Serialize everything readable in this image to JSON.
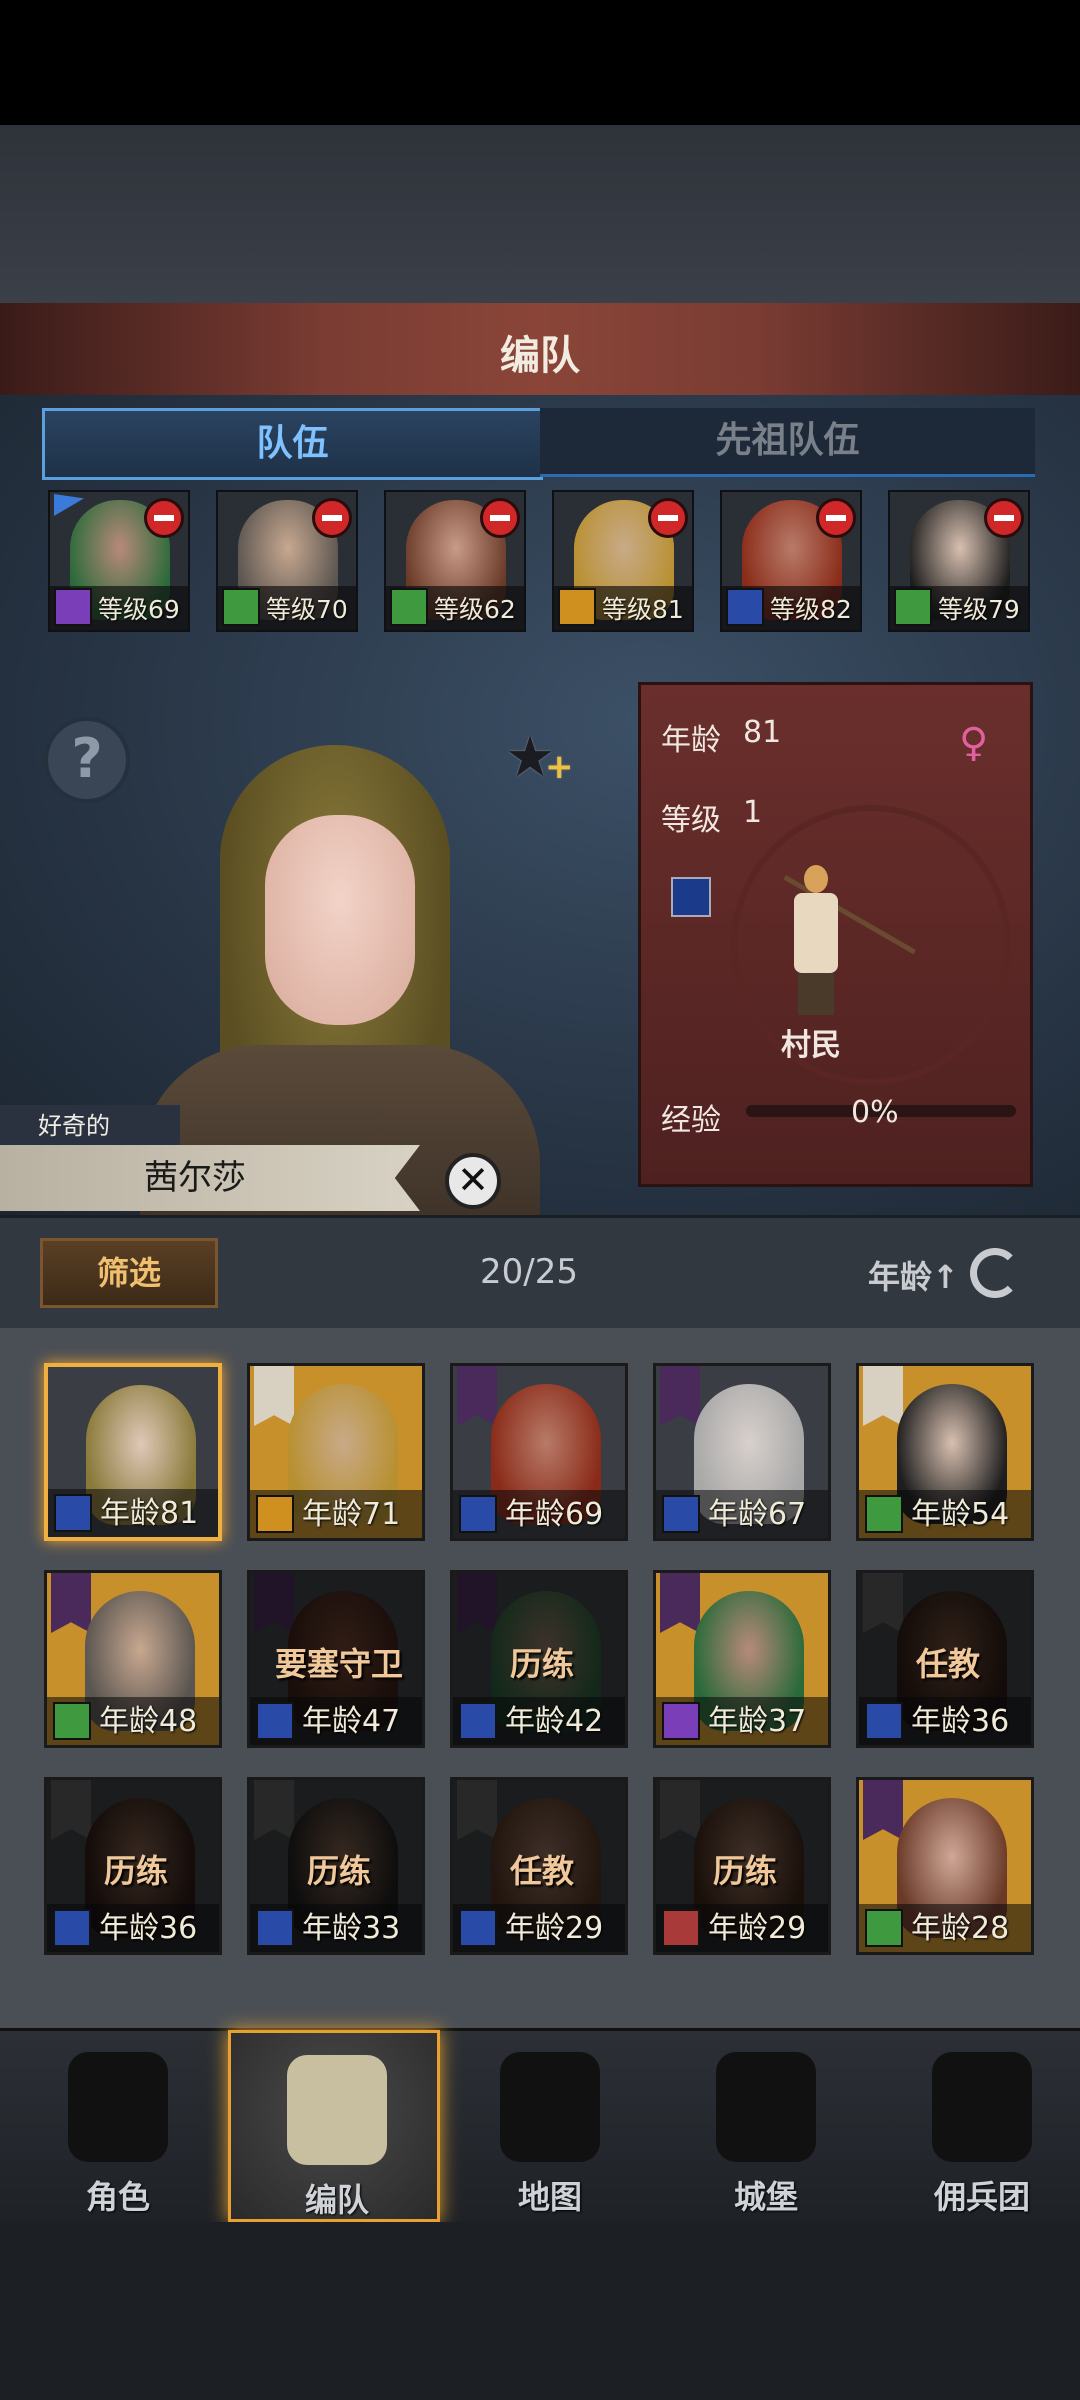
{
  "header": {
    "title": "编队"
  },
  "tabs": [
    {
      "label": "队伍",
      "active": true
    },
    {
      "label": "先祖队伍",
      "active": false
    }
  ],
  "team": [
    {
      "level_text": "等级69",
      "class_color": "#7a3fb8",
      "face": "#b88a7a",
      "hair": "#2a6a3a",
      "bg": "#2a2e35",
      "leader": true
    },
    {
      "level_text": "等级70",
      "class_color": "#3f9a3f",
      "face": "#c8a890",
      "hair": "#5a5550",
      "bg": "#2a2e35"
    },
    {
      "level_text": "等级62",
      "class_color": "#3f9a3f",
      "face": "#c89a88",
      "hair": "#6a3a28",
      "bg": "#2a2e35"
    },
    {
      "level_text": "等级81",
      "class_color": "#d09020",
      "face": "#c8aa88",
      "hair": "#b89030",
      "bg": "#2a2e35"
    },
    {
      "level_text": "等级82",
      "class_color": "#2a4aa8",
      "face": "#b87a68",
      "hair": "#8a2a18",
      "bg": "#2a2e35"
    },
    {
      "level_text": "等级79",
      "class_color": "#3f9a3f",
      "face": "#d8c0b0",
      "hair": "#1e1e1e",
      "bg": "#2a2e35"
    }
  ],
  "help_button": "?",
  "selected": {
    "trait": "好奇的",
    "name": "茜尔莎",
    "age_label": "年龄",
    "age_value": "81",
    "level_label": "等级",
    "level_value": "1",
    "class_name": "村民",
    "exp_label": "经验",
    "exp_value": "0%",
    "exp_fraction": 0.0,
    "gender_icon": "female-symbol"
  },
  "filter": {
    "button": "筛选",
    "count": "20/25",
    "sort": "年龄↑"
  },
  "roster": [
    {
      "age_text": "年龄81",
      "class_color": "#2a4aa8",
      "bg": "#3a3e44",
      "face": "#e0c8b8",
      "hair": "#8a7a3a",
      "selected": true,
      "banner": ""
    },
    {
      "age_text": "年龄71",
      "class_color": "#d09020",
      "bg": "#c8902a",
      "face": "#c8aa88",
      "hair": "#b89030",
      "banner": "#d8d0c0"
    },
    {
      "age_text": "年龄69",
      "class_color": "#2a4aa8",
      "bg": "#3a3e44",
      "face": "#b87a68",
      "hair": "#8a2a18",
      "banner": "#4a2a5a"
    },
    {
      "age_text": "年龄67",
      "class_color": "#2a4aa8",
      "bg": "#3a3e44",
      "face": "#d8d0cc",
      "hair": "#a8a8a8",
      "banner": "#4a2a5a"
    },
    {
      "age_text": "年龄54",
      "class_color": "#3f9a3f",
      "bg": "#c8902a",
      "face": "#d8c0b0",
      "hair": "#1e1e1e",
      "banner": "#d8d0c0"
    },
    {
      "age_text": "年龄48",
      "class_color": "#3f9a3f",
      "bg": "#c8902a",
      "face": "#c8a890",
      "hair": "#5a5550",
      "banner": "#4a2a5a"
    },
    {
      "age_text": "年龄47",
      "class_color": "#2a4aa8",
      "bg": "#3a3e44",
      "face": "#6a4030",
      "hair": "#3a2018",
      "banner": "#4a2a5a",
      "job": "要塞守卫",
      "dimmed": true
    },
    {
      "age_text": "年龄42",
      "class_color": "#2a4aa8",
      "bg": "#3a3e44",
      "face": "#8a7060",
      "hair": "#2a5a3a",
      "banner": "#4a2a5a",
      "job": "历练",
      "dimmed": true
    },
    {
      "age_text": "年龄37",
      "class_color": "#7a3fb8",
      "bg": "#c8902a",
      "face": "#b88a7a",
      "hair": "#2a6a3a",
      "banner": "#4a2a5a"
    },
    {
      "age_text": "年龄36",
      "class_color": "#2a4aa8",
      "bg": "#3a3e44",
      "face": "#6a4a38",
      "hair": "#2a1a14",
      "banner": "#5a5a5a",
      "job": "任教",
      "dimmed": true
    },
    {
      "age_text": "年龄36",
      "class_color": "#2a4aa8",
      "bg": "#3a3e44",
      "face": "#7a5a48",
      "hair": "#2a1a14",
      "banner": "#5a5a5a",
      "job": "历练",
      "dimmed": true
    },
    {
      "age_text": "年龄33",
      "class_color": "#2a4aa8",
      "bg": "#3a3e44",
      "face": "#7a5a48",
      "hair": "#1e1e1e",
      "banner": "#5a5a5a",
      "job": "历练",
      "dimmed": true
    },
    {
      "age_text": "年龄29",
      "class_color": "#2a4aa8",
      "bg": "#3a3e44",
      "face": "#8a6a58",
      "hair": "#4a3020",
      "banner": "#5a5a5a",
      "job": "任教",
      "dimmed": true
    },
    {
      "age_text": "年龄29",
      "class_color": "#a83a3a",
      "bg": "#3a3e44",
      "face": "#8a6a58",
      "hair": "#3a2418",
      "banner": "#5a5a5a",
      "job": "历练",
      "dimmed": true
    },
    {
      "age_text": "年龄28",
      "class_color": "#3f9a3f",
      "bg": "#c8902a",
      "face": "#d0a898",
      "hair": "#6a3a28",
      "banner": "#4a2a5a"
    }
  ],
  "nav": [
    {
      "label": "角色",
      "icon": "knight-icon"
    },
    {
      "label": "编队",
      "icon": "helmet-icon",
      "active": true
    },
    {
      "label": "地图",
      "icon": "compass-map-icon"
    },
    {
      "label": "城堡",
      "icon": "castle-icon"
    },
    {
      "label": "佣兵团",
      "icon": "mercenary-icon"
    }
  ]
}
